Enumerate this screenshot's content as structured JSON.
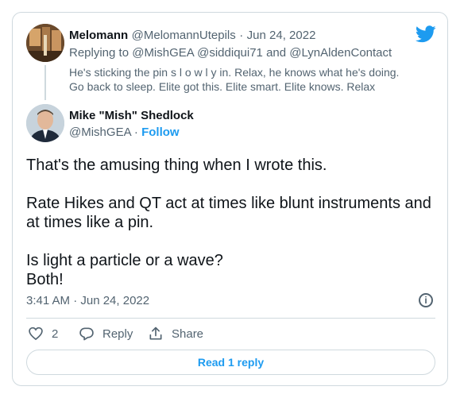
{
  "reply_tweet": {
    "display_name": "Melomann",
    "handle": "@MelomannUtepils",
    "separator": "·",
    "date": "Jun 24, 2022",
    "replying_to": "Replying to @MishGEA @siddiqui71 and @LynAldenContact",
    "text": "He's sticking the pin s l o w l y  in. Relax, he knows what he's doing. Go back to sleep. Elite got this. Elite smart. Elite knows. Relax"
  },
  "main_tweet": {
    "display_name": "Mike \"Mish\" Shedlock",
    "handle": "@MishGEA",
    "follow_sep": "·",
    "follow_label": "Follow",
    "paragraphs": [
      "That's the amusing thing when I wrote this.",
      "Rate Hikes and QT act at times like blunt instruments and at times like a pin.",
      "Is light a particle or a wave?\nBoth!"
    ],
    "timestamp": "3:41 AM · Jun 24, 2022"
  },
  "actions": {
    "like_count": "2",
    "reply_label": "Reply",
    "share_label": "Share"
  },
  "read_replies_label": "Read 1 reply",
  "colors": {
    "accent": "#1d9bf0",
    "text": "#0f1419",
    "secondary": "#536471",
    "border": "#cfd9de"
  },
  "icons": [
    "twitter-bird-icon",
    "info-icon",
    "heart-icon",
    "reply-bubble-icon",
    "share-icon"
  ]
}
